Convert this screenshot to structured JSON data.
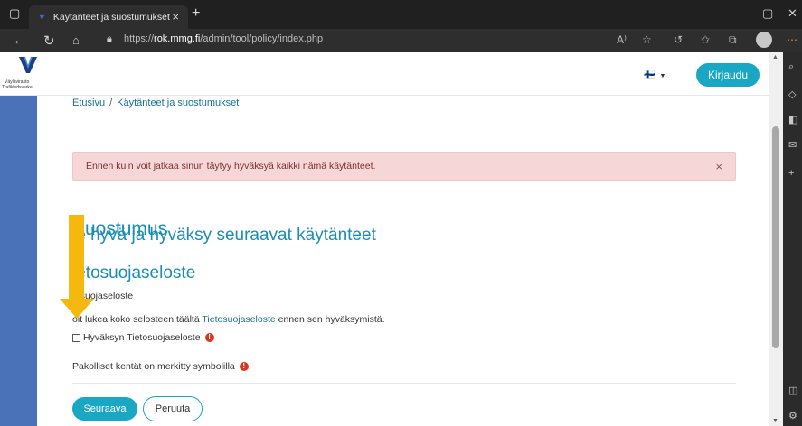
{
  "browser": {
    "tab_title": "Käytänteet ja suostumukset",
    "tab_close": "×",
    "new_tab": "+",
    "url_prefix": "https://",
    "url_domain": "rok.mmg.fi",
    "url_path": "/admin/tool/policy/index.php",
    "icons": [
      "back-icon",
      "refresh-icon",
      "home-icon",
      "lock-icon",
      "read-aloud-icon",
      "favorites-icon",
      "collections-icon",
      "profile-icon",
      "menu-icon"
    ]
  },
  "site": {
    "logo_line1": "Väylävirasto",
    "logo_line2": "Trafikledsverket",
    "lang_label": "🇫🇮",
    "login_label": "Kirjaudu",
    "accent_color": "#1aa7c4",
    "sidebar_color": "#4a72b8"
  },
  "breadcrumb": {
    "home": "Etusivu",
    "separator": "/",
    "current": "Käytänteet ja suostumukset"
  },
  "alert": {
    "message": "Ennen kuin voit jatkaa sinun täytyy hyväksyä kaikki nämä käytänteet.",
    "close": "×"
  },
  "content": {
    "heading": "Suostumus",
    "subheading": "le hyvä ja hyväksy seuraavat käytänteet",
    "policy_title": "ietosuojaseloste",
    "policy_name": "tosuojaseloste",
    "read_full_before": "oit lukea koko selosteen täältä ",
    "read_full_link": "Tietosuojaseloste",
    "read_full_after": " ennen sen hyväksymistä.",
    "agree_label": "Hyväksyn Tietosuojaseloste",
    "required_note_before": "Pakolliset kentät on merkitty symbolilla",
    "required_note_after": " .",
    "required_symbol": "!"
  },
  "buttons": {
    "next": "Seuraava",
    "cancel": "Peruuta"
  }
}
